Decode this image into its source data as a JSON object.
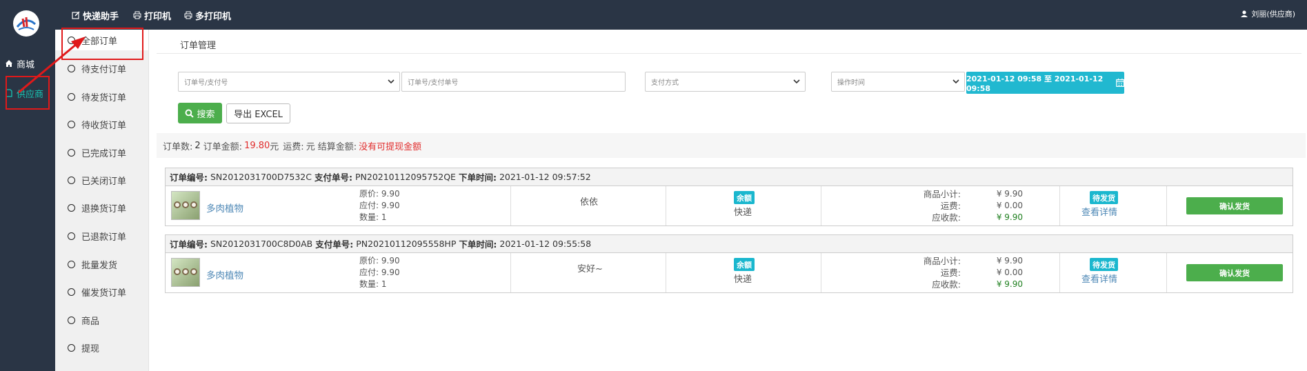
{
  "topbar": {
    "buttons": [
      "快递助手",
      "打印机",
      "多打印机"
    ],
    "user": "刘丽(供应商)"
  },
  "rail": {
    "items": [
      "商城",
      "供应商"
    ]
  },
  "subnav": {
    "items": [
      "全部订单",
      "待支付订单",
      "待发货订单",
      "待收货订单",
      "已完成订单",
      "已关闭订单",
      "退换货订单",
      "已退款订单",
      "批量发货",
      "催发货订单",
      "商品",
      "提现"
    ]
  },
  "breadcrumb": "订单管理",
  "filters": {
    "order_type_placeholder": "订单号/支付号",
    "order_no_placeholder": "订单号/支付单号",
    "pay_method": "支付方式",
    "time_type": "操作时间",
    "date_range": "2021-01-12 09:58 至 2021-01-12 09:58"
  },
  "actions": {
    "search": "搜索",
    "export": "导出 EXCEL"
  },
  "summary": {
    "count_label": "订单数:",
    "count": "2",
    "amount_label": "订单金额:",
    "amount": "19.80",
    "amount_unit": "元",
    "freight_label": "运费:",
    "freight_unit": "元",
    "settle_label": "结算金额:",
    "settle_note": "没有可提现金额"
  },
  "labels": {
    "order_no": "订单编号:",
    "pay_no": "支付单号:",
    "order_time": "下单时间:",
    "orig_price": "原价:",
    "payable": "应付:",
    "quantity": "数量:",
    "subtotal": "商品小计:",
    "freight": "运费:",
    "receivable": "应收款:",
    "view_detail": "查看详情",
    "confirm_ship": "确认发货"
  },
  "orders": [
    {
      "order_no": "SN2012031700D7532C",
      "pay_no": "PN20210112095752QE",
      "order_time": "2021-01-12 09:57:52",
      "product": "多肉植物",
      "orig_price": "9.90",
      "payable": "9.90",
      "quantity": "1",
      "remark": "依依",
      "pay_badge": "余额",
      "shipping": "快递",
      "subtotal": "¥ 9.90",
      "freight": "¥ 0.00",
      "receivable": "¥ 9.90",
      "status": "待发货"
    },
    {
      "order_no": "SN2012031700C8D0AB",
      "pay_no": "PN20210112095558HP",
      "order_time": "2021-01-12 09:55:58",
      "product": "多肉植物",
      "orig_price": "9.90",
      "payable": "9.90",
      "quantity": "1",
      "remark": "安好~",
      "pay_badge": "余额",
      "shipping": "快递",
      "subtotal": "¥ 9.90",
      "freight": "¥ 0.00",
      "receivable": "¥ 9.90",
      "status": "待发货"
    }
  ],
  "colors": {
    "dark_bg": "#2a3545",
    "accent_teal": "#18c4b3",
    "info_blue": "#21b8d0",
    "success_green": "#4cae4c",
    "red": "#e12d2d",
    "annotation_red": "#e0191a"
  }
}
